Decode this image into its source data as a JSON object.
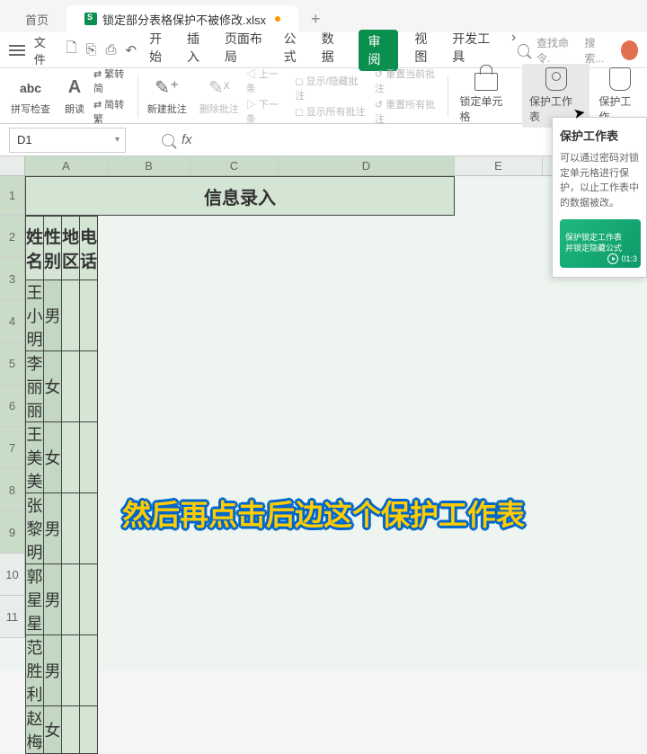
{
  "tabs": {
    "home": "首页",
    "doc": "锁定部分表格保护不被修改.xlsx"
  },
  "menu": {
    "file": "文件",
    "chevron": "›"
  },
  "ribbon": {
    "start": "开始",
    "insert": "插入",
    "layout": "页面布局",
    "formula": "公式",
    "data": "数据",
    "review": "审阅",
    "view": "视图",
    "dev": "开发工具"
  },
  "search": {
    "cmd": "查找命令.",
    "search": "搜索..."
  },
  "tools": {
    "spell": "拼写检查",
    "read": "朗读",
    "fanjian": "繁转简",
    "jianfan": "简转繁",
    "newcomment": "新建批注",
    "delcomment": "删除批注",
    "prev": "上一条",
    "next": "下一条",
    "showhide": "显示/隐藏批注",
    "showall": "显示所有批注",
    "resetcur": "重置当前批注",
    "resetall": "重置所有批注",
    "lockcell": "锁定单元格",
    "protect": "保护工作表",
    "protect2": "保护工作"
  },
  "namebox": "D1",
  "fx": "fx",
  "cols": {
    "A": "A",
    "B": "B",
    "C": "C",
    "D": "D",
    "E": "E"
  },
  "rows": [
    "1",
    "2",
    "3",
    "4",
    "5",
    "6",
    "7",
    "8",
    "9",
    "10",
    "11"
  ],
  "title": "信息录入",
  "headers": {
    "name": "姓名",
    "gender": "性别",
    "region": "地区",
    "phone": "电话"
  },
  "data": [
    {
      "name": "王小明",
      "gender": "男"
    },
    {
      "name": "李丽丽",
      "gender": "女"
    },
    {
      "name": "王美美",
      "gender": "女"
    },
    {
      "name": "张黎明",
      "gender": "男"
    },
    {
      "name": "郭星星",
      "gender": "男"
    },
    {
      "name": "范胜利",
      "gender": "男"
    },
    {
      "name": "赵梅",
      "gender": "女"
    }
  ],
  "tooltip": {
    "title": "保护工作表",
    "text": "可以通过密码对锁定单元格进行保护，以止工作表中的数据被改。",
    "video1": "保护锁定工作表",
    "video2": "并锁定隐藏公式",
    "time": "01:3"
  },
  "subtitle": "然后再点击后边这个保护工作表",
  "abc": "abc",
  "speaker": "A"
}
